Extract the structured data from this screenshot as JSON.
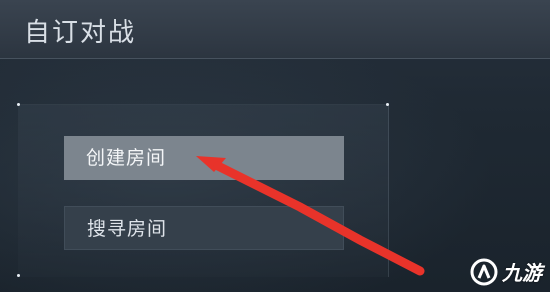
{
  "header": {
    "title": "自订对战"
  },
  "menu": {
    "create_room_label": "创建房间",
    "search_room_label": "搜寻房间",
    "selected": "创建房间"
  },
  "annotation": {
    "arrow_color": "#e8332a"
  },
  "watermark": {
    "text": "九游",
    "icon": "jiuyou-logo-icon"
  }
}
